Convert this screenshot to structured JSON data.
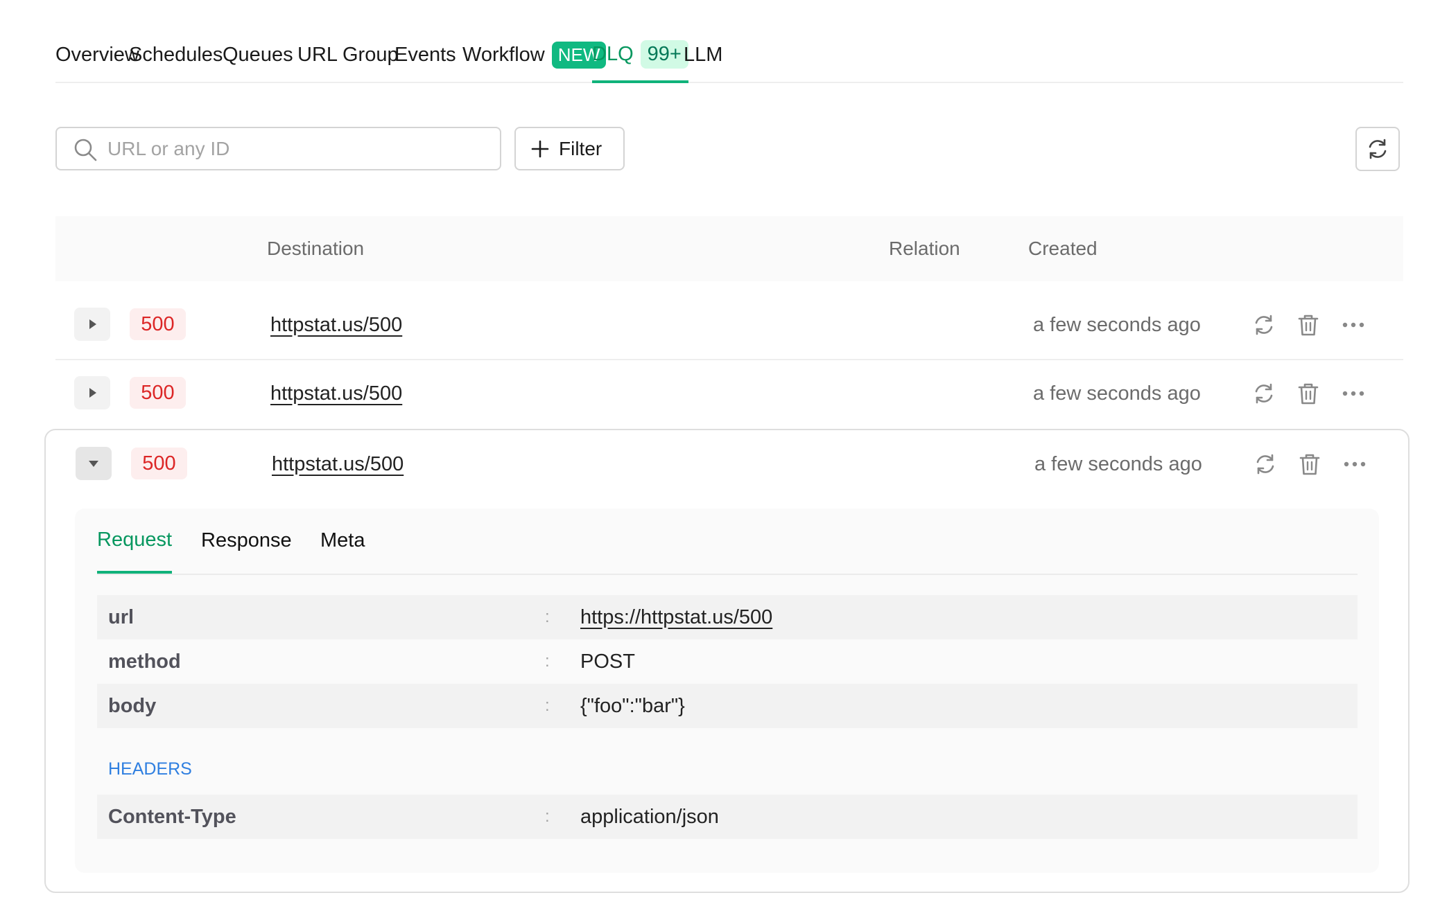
{
  "nav": {
    "tabs": [
      {
        "label": "Overview"
      },
      {
        "label": "Schedules"
      },
      {
        "label": "Queues"
      },
      {
        "label": "URL Group"
      },
      {
        "label": "Events"
      },
      {
        "label": "Workflow",
        "badge": "NEW"
      },
      {
        "label": "DLQ",
        "badge": "99+",
        "active": true
      },
      {
        "label": "LLM"
      }
    ]
  },
  "toolbar": {
    "search_placeholder": "URL or any ID",
    "filter_label": "Filter"
  },
  "table": {
    "columns": [
      "Destination",
      "Relation",
      "Created"
    ],
    "rows": [
      {
        "status": "500",
        "destination": "httpstat.us/500",
        "created": "a few seconds ago",
        "expanded": false
      },
      {
        "status": "500",
        "destination": "httpstat.us/500",
        "created": "a few seconds ago",
        "expanded": false
      },
      {
        "status": "500",
        "destination": "httpstat.us/500",
        "created": "a few seconds ago",
        "expanded": true
      }
    ]
  },
  "detail": {
    "tabs": [
      {
        "label": "Request",
        "active": true
      },
      {
        "label": "Response"
      },
      {
        "label": "Meta"
      }
    ],
    "fields": [
      {
        "key": "url",
        "value": "https://httpstat.us/500"
      },
      {
        "key": "method",
        "value": "POST"
      },
      {
        "key": "body",
        "value": "{\"foo\":\"bar\"}"
      }
    ],
    "headers_label": "HEADERS",
    "headers": [
      {
        "key": "Content-Type",
        "value": "application/json"
      }
    ],
    "separator": ":"
  },
  "colors": {
    "accent": "#10b27a",
    "error": "#dc2626",
    "headers_label": "#2f7fe0"
  }
}
